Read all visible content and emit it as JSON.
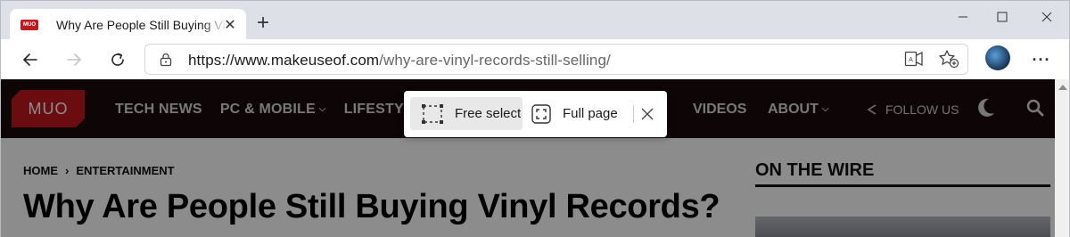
{
  "browser": {
    "tab": {
      "favicon_text": "MUO",
      "title": "Why Are People Still Buying Vinyl Records?",
      "close_label": "✕"
    },
    "new_tab_label": "+",
    "address": {
      "host": "https://www.makeuseof.com",
      "path": "/why-are-vinyl-records-still-selling/"
    },
    "more_label": "···"
  },
  "site": {
    "logo_text": "MUO",
    "nav": [
      {
        "label": "TECH NEWS",
        "has_dropdown": false
      },
      {
        "label": "PC & MOBILE",
        "has_dropdown": true
      },
      {
        "label": "LIFESTY",
        "has_dropdown": false
      }
    ],
    "nav_videos": "VIDEOS",
    "nav_about": "ABOUT",
    "follow_label": "FOLLOW US",
    "breadcrumb": {
      "home": "HOME",
      "separator": "›",
      "section": "ENTERTAINMENT"
    },
    "headline": "Why Are People Still Buying Vinyl Records?",
    "sidebar_title": "ON THE WIRE"
  },
  "capture_toolbar": {
    "free_select": "Free select",
    "full_page": "Full page"
  },
  "colors": {
    "brand_red": "#c3171f",
    "nav_bg": "#1a0c0c",
    "overlay_dim": "rgba(0,0,0,0.45)"
  },
  "icons": {
    "back": "arrow-left-icon",
    "forward": "arrow-right-icon",
    "refresh": "refresh-icon",
    "lock": "lock-icon",
    "reader": "immersive-reader-icon",
    "favorite": "add-favorite-icon",
    "profile": "profile-avatar",
    "share": "share-icon",
    "moon": "moon-icon",
    "search": "search-icon",
    "free_select": "free-select-icon",
    "full_page": "full-page-icon",
    "close": "close-icon"
  }
}
